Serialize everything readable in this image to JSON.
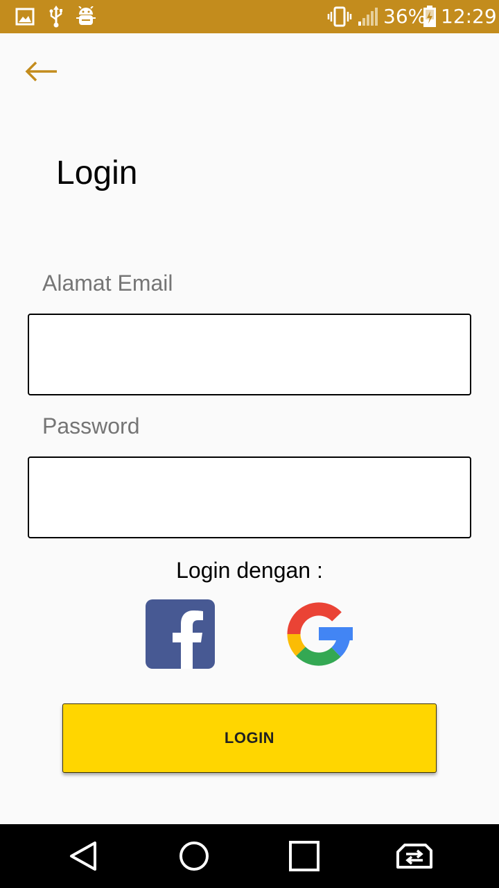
{
  "status_bar": {
    "battery_percent": "36%",
    "time": "12:29",
    "background": "#c38c1d",
    "left_icons": [
      "image-icon",
      "usb-icon",
      "android-debug-icon"
    ],
    "right_icons": [
      "vibrate-icon",
      "signal-icon",
      "battery-charging-icon"
    ]
  },
  "header": {
    "back_icon": "arrow-left-icon",
    "title": "Login",
    "accent": "#c38c1d"
  },
  "form": {
    "email_label": "Alamat Email",
    "email_value": "",
    "password_label": "Password",
    "password_value": ""
  },
  "social": {
    "label": "Login dengan :",
    "providers": [
      "facebook-icon",
      "google-icon"
    ]
  },
  "login_button": {
    "label": "LOGIN",
    "color": "#ffd600"
  },
  "nav_bar": {
    "buttons": [
      "back-triangle-icon",
      "home-circle-icon",
      "recents-square-icon",
      "switch-app-icon"
    ]
  }
}
